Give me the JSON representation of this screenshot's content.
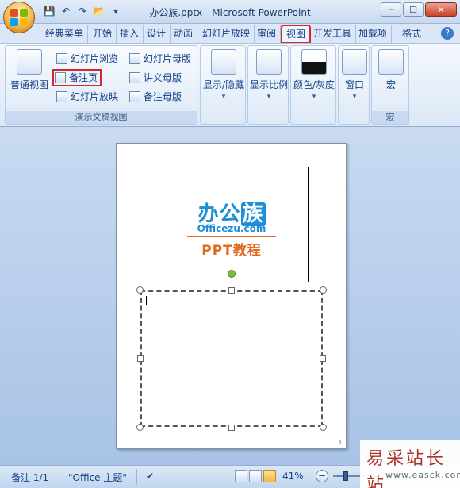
{
  "window": {
    "title": "办公族.pptx - Microsoft PowerPoint",
    "minimize_glyph": "─",
    "maximize_glyph": "☐",
    "close_glyph": "✕"
  },
  "quick_access": {
    "save_icon": "💾",
    "undo_icon": "↶",
    "redo_icon": "↷",
    "open_icon": "📂",
    "more_icon": "▾"
  },
  "tabs": [
    {
      "label": "经典菜单"
    },
    {
      "label": "开始"
    },
    {
      "label": "插入"
    },
    {
      "label": "设计"
    },
    {
      "label": "动画"
    },
    {
      "label": "幻灯片放映"
    },
    {
      "label": "审阅"
    },
    {
      "label": "视图",
      "active": true,
      "highlighted": true
    },
    {
      "label": "开发工具"
    },
    {
      "label": "加载项"
    },
    {
      "label": "格式"
    }
  ],
  "help_glyph": "?",
  "ribbon": {
    "presentation_views": {
      "group_label": "演示文稿视图",
      "normal": "普通视图",
      "slide_sorter": "幻灯片浏览",
      "notes_page": "备注页",
      "slide_show": "幻灯片放映",
      "slide_master": "幻灯片母版",
      "handout_master": "讲义母版",
      "notes_master": "备注母版"
    },
    "show_hide": "显示/隐藏",
    "zoom": "显示比例",
    "color_gray": "颜色/灰度",
    "window": "窗口",
    "macros": {
      "button": "宏",
      "group_label": "宏"
    },
    "dropdown_glyph": "▾"
  },
  "slide": {
    "logo_text_a": "办公",
    "logo_text_b": "族",
    "logo_url": "Officezu.com",
    "logo_ppt": "PPT教程"
  },
  "status": {
    "notes_count": "备注 1/1",
    "theme": "\"Office 主题\"",
    "spell_icon": "✔",
    "zoom_level": "41%",
    "zoom_minus": "−",
    "zoom_fraction": 0.41
  },
  "watermark": {
    "cn": "易采站长站",
    "en": "www.easck.com"
  },
  "accent_colors": {
    "highlight_red": "#d62a2a",
    "logo_blue": "#1e8fd6",
    "logo_orange": "#e06a1b"
  }
}
